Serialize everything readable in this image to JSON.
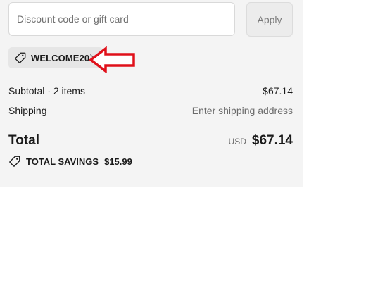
{
  "discount": {
    "placeholder": "Discount code or gift card",
    "apply_label": "Apply"
  },
  "applied_code": {
    "label": "WELCOME20",
    "icon": "tag-icon",
    "remove_icon": "close-icon"
  },
  "annotation": {
    "icon": "arrow-left-icon",
    "color": "#e0101a"
  },
  "summary": {
    "subtotal_label": "Subtotal · 2 items",
    "subtotal_value": "$67.14",
    "shipping_label": "Shipping",
    "shipping_value": "Enter shipping address",
    "total_label": "Total",
    "currency": "USD",
    "total_value": "$67.14",
    "savings_label": "TOTAL SAVINGS",
    "savings_value": "$15.99"
  }
}
